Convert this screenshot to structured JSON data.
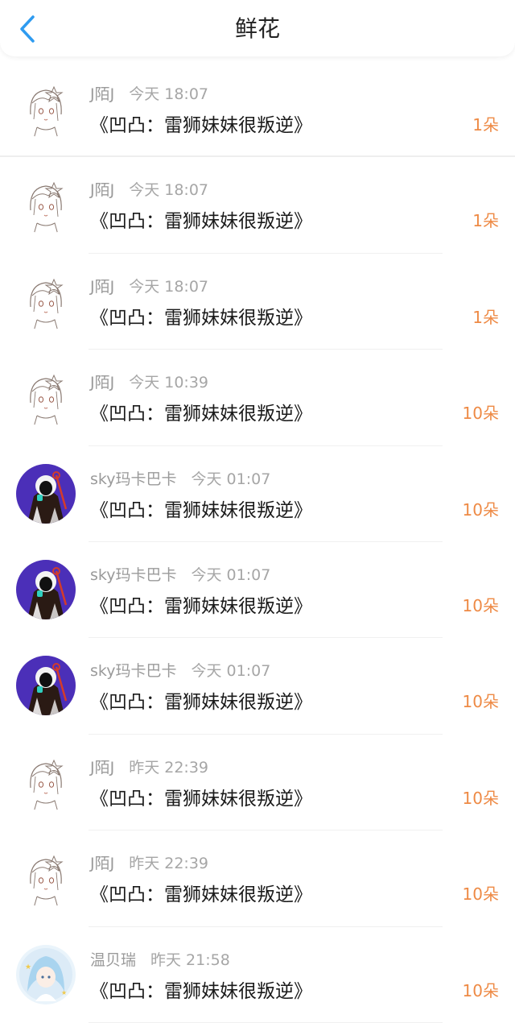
{
  "header": {
    "title": "鲜花",
    "back_icon": "chevron-left-icon",
    "accent": "#2e9bf0"
  },
  "flower_color": "#ee8a45",
  "rows": [
    {
      "user": "J陌J",
      "time": "今天 18:07",
      "book": "《凹凸：雷狮妹妹很叛逆》",
      "count": "1朵",
      "avatar": "sketch-girl"
    },
    {
      "user": "J陌J",
      "time": "今天 18:07",
      "book": "《凹凸：雷狮妹妹很叛逆》",
      "count": "1朵",
      "avatar": "sketch-girl"
    },
    {
      "user": "J陌J",
      "time": "今天 18:07",
      "book": "《凹凸：雷狮妹妹很叛逆》",
      "count": "1朵",
      "avatar": "sketch-girl"
    },
    {
      "user": "J陌J",
      "time": "今天 10:39",
      "book": "《凹凸：雷狮妹妹很叛逆》",
      "count": "10朵",
      "avatar": "sketch-girl"
    },
    {
      "user": "sky玛卡巴卡",
      "time": "今天 01:07",
      "book": "《凹凸：雷狮妹妹很叛逆》",
      "count": "10朵",
      "avatar": "purple-hood"
    },
    {
      "user": "sky玛卡巴卡",
      "time": "今天 01:07",
      "book": "《凹凸：雷狮妹妹很叛逆》",
      "count": "10朵",
      "avatar": "purple-hood"
    },
    {
      "user": "sky玛卡巴卡",
      "time": "今天 01:07",
      "book": "《凹凸：雷狮妹妹很叛逆》",
      "count": "10朵",
      "avatar": "purple-hood"
    },
    {
      "user": "J陌J",
      "time": "昨天 22:39",
      "book": "《凹凸：雷狮妹妹很叛逆》",
      "count": "10朵",
      "avatar": "sketch-girl"
    },
    {
      "user": "J陌J",
      "time": "昨天 22:39",
      "book": "《凹凸：雷狮妹妹很叛逆》",
      "count": "10朵",
      "avatar": "sketch-girl"
    },
    {
      "user": "温贝瑞",
      "time": "昨天 21:58",
      "book": "《凹凸：雷狮妹妹很叛逆》",
      "count": "10朵",
      "avatar": "blue-anime"
    }
  ]
}
